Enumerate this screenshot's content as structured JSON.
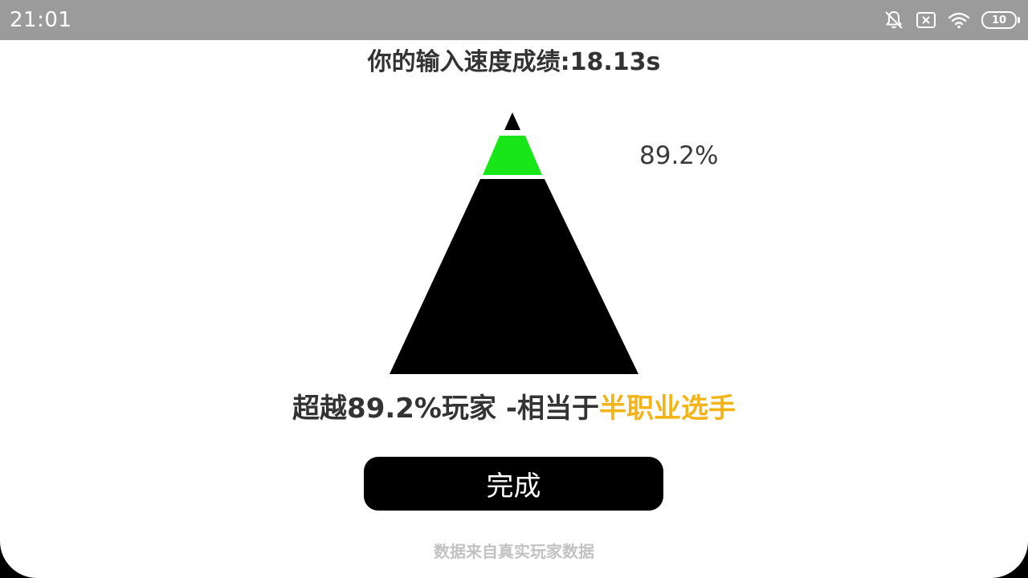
{
  "status_bar": {
    "time": "21:01",
    "battery_level": "10",
    "icons": [
      "notifications-off-icon",
      "sim-card-icon",
      "wifi-icon",
      "battery-icon"
    ],
    "background_color": "#9b9b9b"
  },
  "result": {
    "title": "你的输入速度成绩:18.13s",
    "percentile_label": "89.2%",
    "percentile_value": 89.2,
    "summary_prefix": "超越89.2%玩家 -相当于",
    "rank_title": "半职业选手",
    "rank_color": "#f2b419"
  },
  "pyramid": {
    "colors": {
      "top_tier": "#000000",
      "current_tier": "#19e619",
      "base_tier": "#000000"
    }
  },
  "actions": {
    "done_label": "完成"
  },
  "footer": {
    "source_note": "数据来自真实玩家数据"
  }
}
